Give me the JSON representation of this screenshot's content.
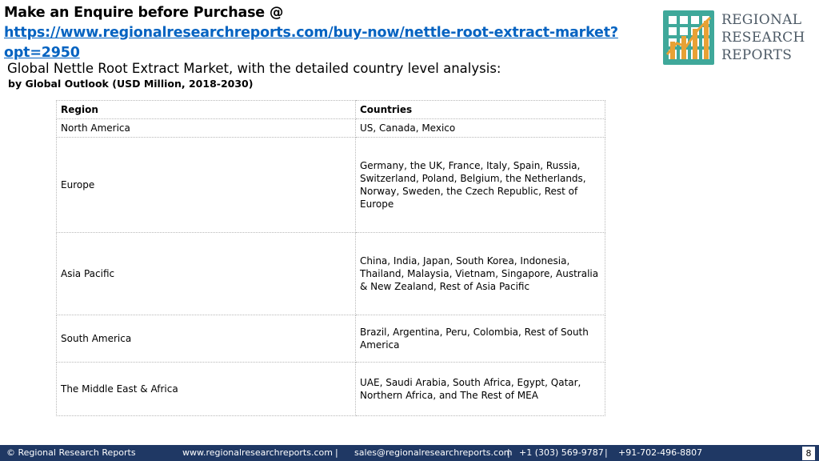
{
  "header": {
    "enquire_prefix": "Make an Enquire before Purchase @ ",
    "enquire_link": "https://www.regionalresearchreports.com/buy-now/nettle-root-extract-market?opt=2950"
  },
  "logo": {
    "line1": "REGIONAL",
    "line2": "RESEARCH",
    "line3": "REPORTS",
    "colors": {
      "teal": "#3fa89a",
      "orange": "#e8a135",
      "text": "#4d5a66"
    }
  },
  "title": "Global Nettle Root Extract Market, with the detailed country level analysis:",
  "subtitle": "by Global Outlook (USD Million, 2018-2030)",
  "table": {
    "headers": [
      "Region",
      "Countries"
    ],
    "rows": [
      [
        "North America",
        "US, Canada, Mexico"
      ],
      [
        "Europe",
        "Germany, the UK, France, Italy, Spain, Russia, Switzerland, Poland, Belgium, the Netherlands, Norway, Sweden, the Czech Republic, Rest of Europe"
      ],
      [
        "Asia Pacific",
        "China, India, Japan, South Korea, Indonesia, Thailand, Malaysia, Vietnam, Singapore, Australia & New Zealand, Rest of Asia Pacific"
      ],
      [
        "South America",
        "Brazil, Argentina, Peru, Colombia, Rest of South America"
      ],
      [
        "The Middle East & Africa",
        "UAE, Saudi Arabia, South Africa, Egypt, Qatar, Northern Africa, and The Rest of MEA"
      ]
    ]
  },
  "footer": {
    "copyright": "© Regional Research Reports",
    "website": "www.regionalresearchreports.com",
    "sep1": "|",
    "email": "sales@regionalresearchreports.com",
    "sep2": "|",
    "phone1": "+1 (303) 569-9787",
    "sep3": "|",
    "phone2": "+91-702-496-8807",
    "page": "8",
    "bg_color": "#1f3864"
  }
}
